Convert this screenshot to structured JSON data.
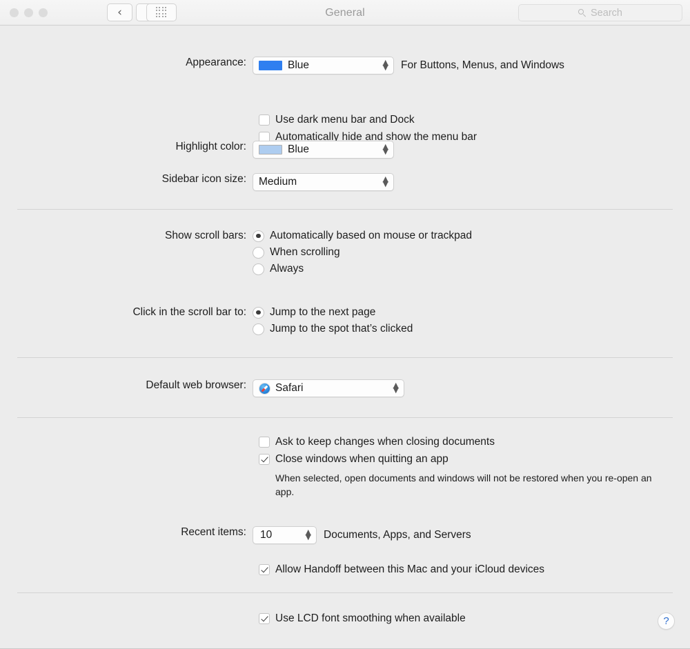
{
  "window": {
    "title": "General",
    "background_color": "#ececec"
  },
  "toolbar": {
    "title": "General",
    "back_glyph": "‹",
    "forward_glyph": "›",
    "grid_button_name": "Show All",
    "search": {
      "placeholder": "Search",
      "value": ""
    }
  },
  "appearance": {
    "label": "Appearance:",
    "value": "Blue",
    "swatch_color": "#2f7ff0",
    "hint": "For Buttons, Menus, and Windows",
    "checkboxes": [
      {
        "label": "Use dark menu bar and Dock",
        "checked": false
      },
      {
        "label": "Automatically hide and show the menu bar",
        "checked": false
      }
    ]
  },
  "highlight_color": {
    "label": "Highlight color:",
    "value": "Blue",
    "swatch_color": "#aecdf0"
  },
  "sidebar_icon_size": {
    "label": "Sidebar icon size:",
    "value": "Medium"
  },
  "show_scroll_bars": {
    "label": "Show scroll bars:",
    "options": [
      {
        "label": "Automatically based on mouse or trackpad",
        "selected": true
      },
      {
        "label": "When scrolling",
        "selected": false
      },
      {
        "label": "Always",
        "selected": false
      }
    ]
  },
  "click_scroll_bar": {
    "label": "Click in the scroll bar to:",
    "options": [
      {
        "label": "Jump to the next page",
        "selected": true
      },
      {
        "label": "Jump to the spot that’s clicked",
        "selected": false
      }
    ]
  },
  "default_web_browser": {
    "label": "Default web browser:",
    "value": "Safari",
    "icon": "safari-icon"
  },
  "documents": {
    "ask_to_keep": {
      "label": "Ask to keep changes when closing documents",
      "checked": false
    },
    "close_windows": {
      "label": "Close windows when quitting an app",
      "checked": true
    },
    "helper_text": "When selected, open documents and windows will not be restored when you re-open an app."
  },
  "recent_items": {
    "label": "Recent items:",
    "value": "10",
    "suffix": "Documents, Apps, and Servers"
  },
  "handoff": {
    "label": "Allow Handoff between this Mac and your iCloud devices",
    "checked": true
  },
  "font_smoothing": {
    "label": "Use LCD font smoothing when available",
    "checked": true
  },
  "help_button": {
    "glyph": "?",
    "accent_color": "#2f6fd0"
  }
}
